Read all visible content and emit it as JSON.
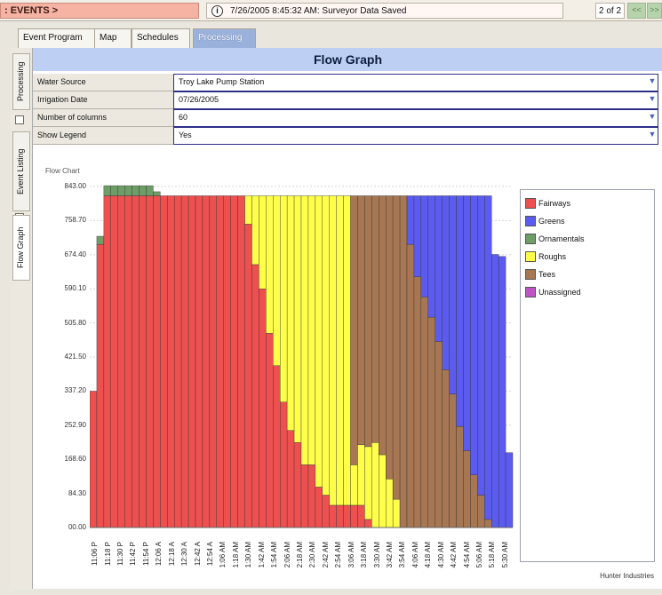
{
  "titlebar": {
    "section": ": EVENTS >",
    "status_text": "7/26/2005 8:45:32 AM: Surveyor Data Saved",
    "pager": "2 of 2",
    "nav_first": "<<",
    "nav_next": ">>"
  },
  "tabs": [
    "Event Program",
    "Map",
    "Schedules",
    "Processing"
  ],
  "sidebar": [
    "Processing",
    "Event Listing",
    "Flow Graph"
  ],
  "main": {
    "title": "Flow Graph",
    "fields": [
      {
        "label": "Water Source",
        "value": "Troy Lake Pump Station"
      },
      {
        "label": "Irrigation Date",
        "value": "07/26/2005"
      },
      {
        "label": "Number of columns",
        "value": "60"
      },
      {
        "label": "Show Legend",
        "value": "Yes"
      }
    ]
  },
  "chart_data": {
    "type": "bar",
    "title": "Flow Chart",
    "y_ticks": [
      "843.00",
      "758.70",
      "674.40",
      "590.10",
      "505.80",
      "421.50",
      "337.20",
      "252.90",
      "168.60",
      "84.30",
      "00.00"
    ],
    "ylim": [
      0,
      843
    ],
    "x_tick_labels": [
      "11:06 P",
      "11:18 P",
      "11:30 P",
      "11:42 P",
      "11:54 P",
      "12:06 A",
      "12:18 A",
      "12:30 A",
      "12:42 A",
      "12:54 A",
      "1:06 AM",
      "1:18 AM",
      "1:30 AM",
      "1:42 AM",
      "1:54 AM",
      "2:06 AM",
      "2:18 AM",
      "2:30 AM",
      "2:42 AM",
      "2:54 AM",
      "3:06 AM",
      "3:18 AM",
      "3:30 AM",
      "3:42 AM",
      "3:54 AM",
      "4:06 AM",
      "4:18 AM",
      "4:30 AM",
      "4:42 AM",
      "4:54 AM",
      "5:06 AM",
      "5:18 AM",
      "5:30 AM"
    ],
    "legend": [
      {
        "name": "Fairways",
        "color": "#ee5050"
      },
      {
        "name": "Greens",
        "color": "#5b5bf0"
      },
      {
        "name": "Ornamentals",
        "color": "#6e9d68"
      },
      {
        "name": "Roughs",
        "color": "#ffff4a"
      },
      {
        "name": "Tees",
        "color": "#a77653"
      },
      {
        "name": "Unassigned",
        "color": "#bd55c4"
      }
    ],
    "stacked_series": [
      {
        "name": "Fairways",
        "color": "#ee5050",
        "values": [
          337,
          700,
          820,
          820,
          820,
          820,
          820,
          820,
          820,
          820,
          820,
          820,
          820,
          820,
          820,
          820,
          820,
          820,
          820,
          820,
          820,
          820,
          750,
          650,
          590,
          480,
          400,
          310,
          240,
          210,
          155,
          155,
          100,
          80,
          55,
          55,
          55,
          55,
          55,
          20,
          0,
          0,
          0,
          0,
          0,
          0,
          0,
          0,
          0,
          0,
          0,
          0,
          0,
          0,
          0,
          0,
          0,
          0,
          0,
          0
        ]
      },
      {
        "name": "Roughs",
        "color": "#ffff4a",
        "values": [
          0,
          0,
          0,
          0,
          0,
          0,
          0,
          0,
          0,
          0,
          0,
          0,
          0,
          0,
          0,
          0,
          0,
          0,
          0,
          0,
          0,
          0,
          70,
          170,
          230,
          340,
          420,
          510,
          580,
          610,
          665,
          665,
          720,
          740,
          765,
          765,
          765,
          100,
          150,
          180,
          210,
          180,
          120,
          70,
          0,
          0,
          0,
          0,
          0,
          0,
          0,
          0,
          0,
          0,
          0,
          0,
          0,
          0,
          0,
          0
        ]
      },
      {
        "name": "Tees",
        "color": "#a77653",
        "values": [
          0,
          0,
          0,
          0,
          0,
          0,
          0,
          0,
          0,
          0,
          0,
          0,
          0,
          0,
          0,
          0,
          0,
          0,
          0,
          0,
          0,
          0,
          0,
          0,
          0,
          0,
          0,
          0,
          0,
          0,
          0,
          0,
          0,
          0,
          0,
          0,
          0,
          665,
          615,
          620,
          610,
          640,
          700,
          750,
          820,
          700,
          620,
          570,
          520,
          460,
          390,
          330,
          250,
          190,
          130,
          80,
          20,
          0,
          0,
          0
        ]
      },
      {
        "name": "Greens",
        "color": "#5b5bf0",
        "values": [
          0,
          0,
          0,
          0,
          0,
          0,
          0,
          0,
          0,
          0,
          0,
          0,
          0,
          0,
          0,
          0,
          0,
          0,
          0,
          0,
          0,
          0,
          0,
          0,
          0,
          0,
          0,
          0,
          0,
          0,
          0,
          0,
          0,
          0,
          0,
          0,
          0,
          0,
          0,
          0,
          0,
          0,
          0,
          0,
          0,
          120,
          200,
          250,
          300,
          360,
          430,
          490,
          570,
          630,
          690,
          740,
          800,
          675,
          670,
          185
        ]
      },
      {
        "name": "Ornamentals",
        "color": "#6e9d68",
        "values": [
          0,
          20,
          25,
          25,
          25,
          25,
          25,
          25,
          25,
          10,
          0,
          0,
          0,
          0,
          0,
          0,
          0,
          0,
          0,
          0,
          0,
          0,
          0,
          0,
          0,
          0,
          0,
          0,
          0,
          0,
          0,
          0,
          0,
          0,
          0,
          0,
          0,
          0,
          0,
          0,
          0,
          0,
          0,
          0,
          0,
          0,
          0,
          0,
          0,
          0,
          0,
          0,
          0,
          0,
          0,
          0,
          0,
          0,
          0,
          0
        ]
      }
    ]
  },
  "company": "Hunter Industries"
}
